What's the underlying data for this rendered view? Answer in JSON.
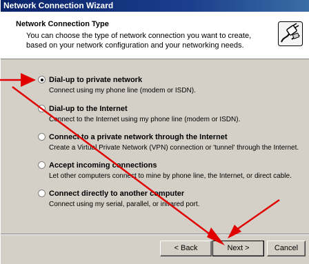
{
  "window": {
    "title": "Network Connection Wizard"
  },
  "header": {
    "title": "Network Connection Type",
    "description": "You can choose the type of network connection you want to create, based on your network configuration and your networking needs."
  },
  "options": [
    {
      "label": "Dial-up to private network",
      "description": "Connect using my phone line (modem or ISDN).",
      "selected": true
    },
    {
      "label": "Dial-up to the Internet",
      "description": "Connect to the Internet using my phone line (modem or ISDN).",
      "selected": false
    },
    {
      "label": "Connect to a private network through the Internet",
      "description": "Create a Virtual Private Network (VPN) connection or 'tunnel' through the Internet.",
      "selected": false
    },
    {
      "label": "Accept incoming connections",
      "description": "Let other computers connect to mine by phone line, the Internet, or direct cable.",
      "selected": false
    },
    {
      "label": "Connect directly to another computer",
      "description": "Connect using my serial, parallel, or infrared port.",
      "selected": false
    }
  ],
  "buttons": {
    "back": "< Back",
    "next": "Next >",
    "cancel": "Cancel"
  },
  "colors": {
    "annotation_arrow": "#e00000",
    "titlebar": "#0a246a",
    "dialog_face": "#d4d0c8"
  },
  "icons": {
    "header": "phone-plug-icon"
  }
}
